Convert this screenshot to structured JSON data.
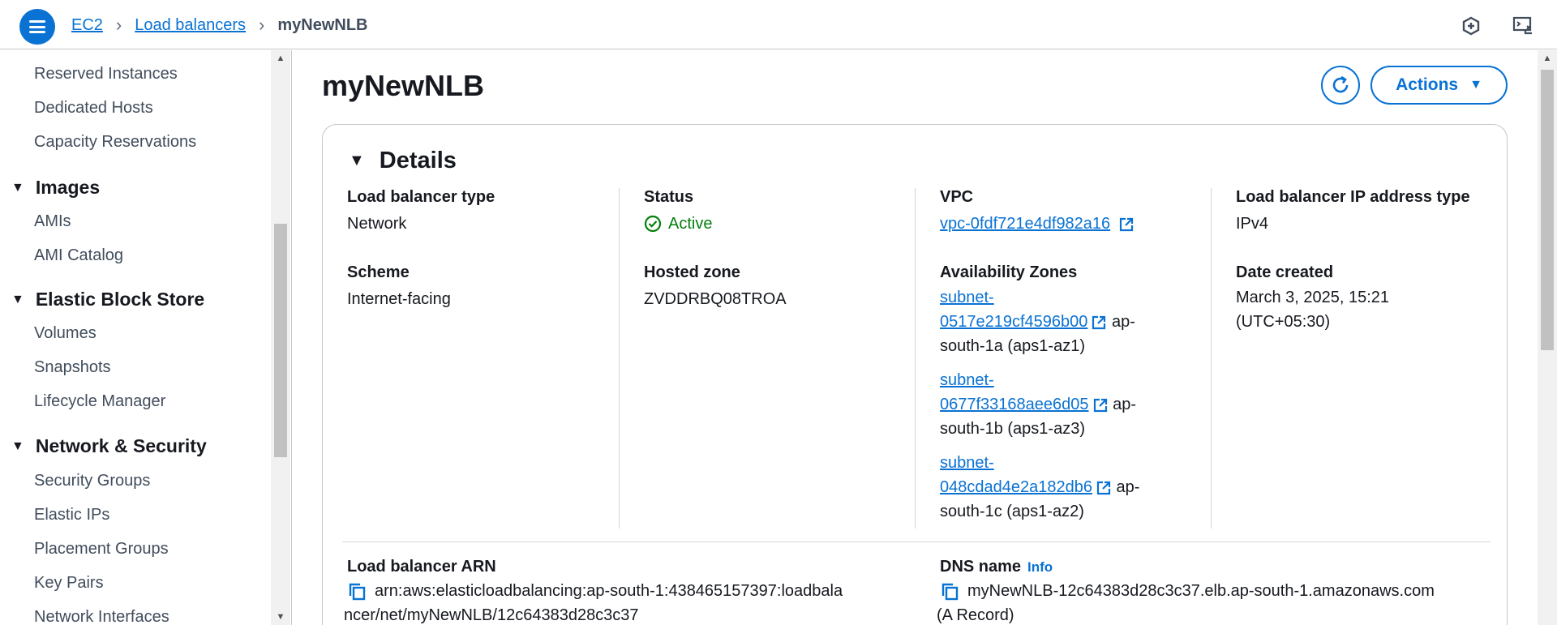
{
  "breadcrumb": {
    "ec2": "EC2",
    "load_balancers": "Load balancers",
    "current": "myNewNLB"
  },
  "sidebar": {
    "items_top": [
      "Reserved Instances",
      "Dedicated Hosts",
      "Capacity Reservations"
    ],
    "images": {
      "title": "Images",
      "items": [
        "AMIs",
        "AMI Catalog"
      ]
    },
    "ebs": {
      "title": "Elastic Block Store",
      "items": [
        "Volumes",
        "Snapshots",
        "Lifecycle Manager"
      ]
    },
    "network": {
      "title": "Network & Security",
      "items": [
        "Security Groups",
        "Elastic IPs",
        "Placement Groups",
        "Key Pairs",
        "Network Interfaces"
      ]
    }
  },
  "page": {
    "title": "myNewNLB",
    "actions_label": "Actions"
  },
  "details": {
    "header": "Details",
    "lb_type": {
      "label": "Load balancer type",
      "value": "Network"
    },
    "scheme": {
      "label": "Scheme",
      "value": "Internet-facing"
    },
    "status": {
      "label": "Status",
      "value": "Active"
    },
    "hosted_zone": {
      "label": "Hosted zone",
      "value": "ZVDDRBQ08TROA"
    },
    "vpc": {
      "label": "VPC",
      "value": "vpc-0fdf721e4df982a16"
    },
    "azs": {
      "label": "Availability Zones",
      "subnets": [
        {
          "line1": "subnet-",
          "line2": "0517e219cf4596b00",
          "suffix1": "ap-",
          "suffix2": "south-1a (aps1-az1)"
        },
        {
          "line1": "subnet-",
          "line2": "0677f33168aee6d05",
          "suffix1": "ap-",
          "suffix2": "south-1b (aps1-az3)"
        },
        {
          "line1": "subnet-",
          "line2": "048cdad4e2a182db6",
          "suffix1": "ap-",
          "suffix2": "south-1c (aps1-az2)"
        }
      ]
    },
    "ip_type": {
      "label": "Load balancer IP address type",
      "value": "IPv4"
    },
    "date_created": {
      "label": "Date created",
      "line1": "March 3, 2025, 15:21",
      "line2": "(UTC+05:30)"
    },
    "arn": {
      "label": "Load balancer ARN",
      "line1": "arn:aws:elasticloadbalancing:ap-south-1:438465157397:loadbala",
      "line2": "ncer/net/myNewNLB/12c64383d28c3c37"
    },
    "dns": {
      "label": "DNS name",
      "info": "Info",
      "line1": "myNewNLB-12c64383d28c3c37.elb.ap-south-1.amazonaws.com",
      "line2": "(A Record)"
    }
  },
  "colors": {
    "accent": "#0972d3",
    "success": "#037f0c",
    "text": "#16191f"
  }
}
